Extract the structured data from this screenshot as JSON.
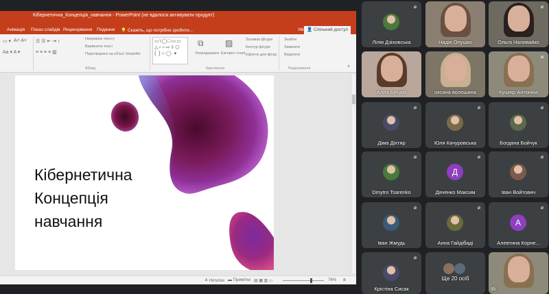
{
  "powerpoint": {
    "window_title": "Кібернетична_Концепція_навчання - PowerPoint (не вдалося активувати продукт)",
    "tabs": [
      "Анімація",
      "Показ слайдів",
      "Рецензування",
      "Подання"
    ],
    "tell_me": "Скажіть, що потрібно зробити...",
    "sign_in": "Увійти",
    "share": "Спільний доступ",
    "ribbon": {
      "text_direction": "Напрямок тексту",
      "align_text": "Вирівняти текст",
      "convert_smartart": "Перетворити на об'єкт SmartArt",
      "paragraph_group": "Абзац",
      "arrange": "Упорядкувати",
      "quick_styles": "Експрес-стилі",
      "shape_fill": "Заливка фігури",
      "shape_outline": "Контур фігури",
      "shape_effects": "Ефекти для фігур",
      "drawing_group": "Креслення",
      "find": "Знайти",
      "replace": "Замінити",
      "select": "Виділити",
      "editing_group": "Редагування"
    },
    "slide_title": "Кібернетична\nКонцепція\nнавчання",
    "status": {
      "notes": "Нотатки",
      "comments": "Примітки",
      "zoom": "76%"
    }
  },
  "participants": [
    {
      "name": "Лілія Дзіховська",
      "type": "avatar",
      "muted": true
    },
    {
      "name": "Надія Опушко",
      "type": "video",
      "muted": false
    },
    {
      "name": "Ольга Наливайко",
      "type": "video",
      "muted": true
    },
    {
      "name": "Алла Бендій",
      "type": "video",
      "muted": false
    },
    {
      "name": "оксана волошина",
      "type": "video",
      "muted": false
    },
    {
      "name": "Кушнір Антоніна",
      "type": "video",
      "muted": true
    },
    {
      "name": "Діма Діхтяр",
      "type": "avatar",
      "muted": true
    },
    {
      "name": "Юля Качуровська",
      "type": "avatar",
      "muted": true
    },
    {
      "name": "Богдана Бойчук",
      "type": "avatar",
      "muted": true
    },
    {
      "name": "Dmytro Tsarenko",
      "type": "avatar",
      "muted": true
    },
    {
      "name": "Дяченко Максим",
      "type": "letter",
      "letter": "Д",
      "color": "#8e3fbf",
      "muted": true
    },
    {
      "name": "Іван Войтович",
      "type": "avatar",
      "muted": true
    },
    {
      "name": "Іван Жмудь",
      "type": "avatar",
      "muted": true
    },
    {
      "name": "Анна Гайдібаді",
      "type": "avatar",
      "muted": true
    },
    {
      "name": "Алевтина Корне...",
      "type": "letter",
      "letter": "А",
      "color": "#8e3fbf",
      "muted": true
    },
    {
      "name": "Крістіна Сисак",
      "type": "avatar",
      "muted": true
    },
    {
      "name": "Ще 20 осіб",
      "type": "more",
      "muted": false
    },
    {
      "name": "Ві",
      "type": "video",
      "muted": false
    }
  ]
}
